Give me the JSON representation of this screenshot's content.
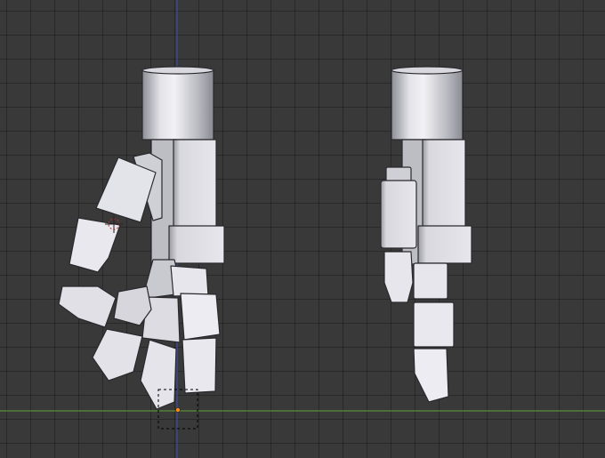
{
  "viewport": {
    "background": "#393939",
    "grid_color": "#2b2b2b",
    "axis_x_color": "#5a8f3a",
    "axis_z_color": "#3c4fa6",
    "object_origin_color": "#ff8c1a",
    "selection_outline_color": "#000000",
    "cursor_color": "#c83232"
  },
  "scene": {
    "objects": [
      "robot-hand-curled",
      "robot-hand-straight"
    ],
    "cursor_icon": "3d-cursor-icon"
  }
}
